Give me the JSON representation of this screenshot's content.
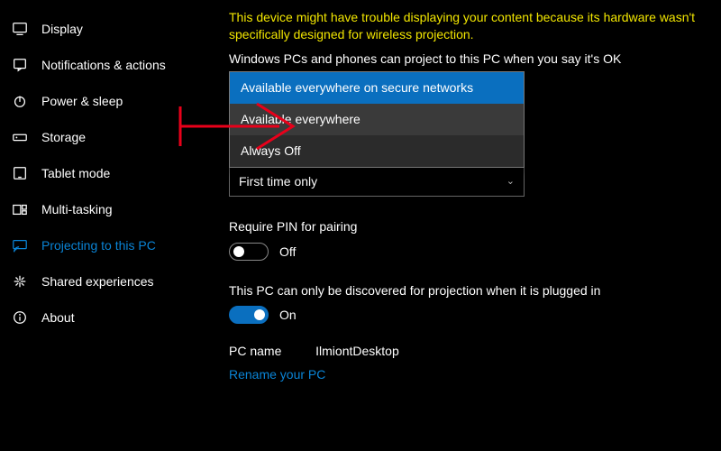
{
  "sidebar": {
    "items": [
      {
        "label": "Display",
        "icon": "display-icon"
      },
      {
        "label": "Notifications & actions",
        "icon": "notifications-icon"
      },
      {
        "label": "Power & sleep",
        "icon": "power-icon"
      },
      {
        "label": "Storage",
        "icon": "storage-icon"
      },
      {
        "label": "Tablet mode",
        "icon": "tablet-icon"
      },
      {
        "label": "Multi-tasking",
        "icon": "multitasking-icon"
      },
      {
        "label": "Projecting to this PC",
        "icon": "projecting-icon"
      },
      {
        "label": "Shared experiences",
        "icon": "shared-icon"
      },
      {
        "label": "About",
        "icon": "about-icon"
      }
    ],
    "selected_index": 6
  },
  "content": {
    "warning": "This device might have trouble displaying your content because its hardware wasn't specifically designed for wireless projection.",
    "project_label": "Windows PCs and phones can project to this PC when you say it's OK",
    "project_dropdown": {
      "options": [
        "Available everywhere on secure networks",
        "Available everywhere",
        "Always Off"
      ],
      "hovered_index": 0,
      "selected_index": 1
    },
    "ask_dropdown": {
      "selected": "First time only"
    },
    "require_pin": {
      "label": "Require PIN for pairing",
      "on": false,
      "text": "Off"
    },
    "discover": {
      "label": "This PC can only be discovered for projection when it is plugged in",
      "on": true,
      "text": "On"
    },
    "pc_name_label": "PC name",
    "pc_name_value": "IlmiontDesktop",
    "rename_link": "Rename your PC"
  },
  "annotation": {
    "color": "#e8001a"
  }
}
